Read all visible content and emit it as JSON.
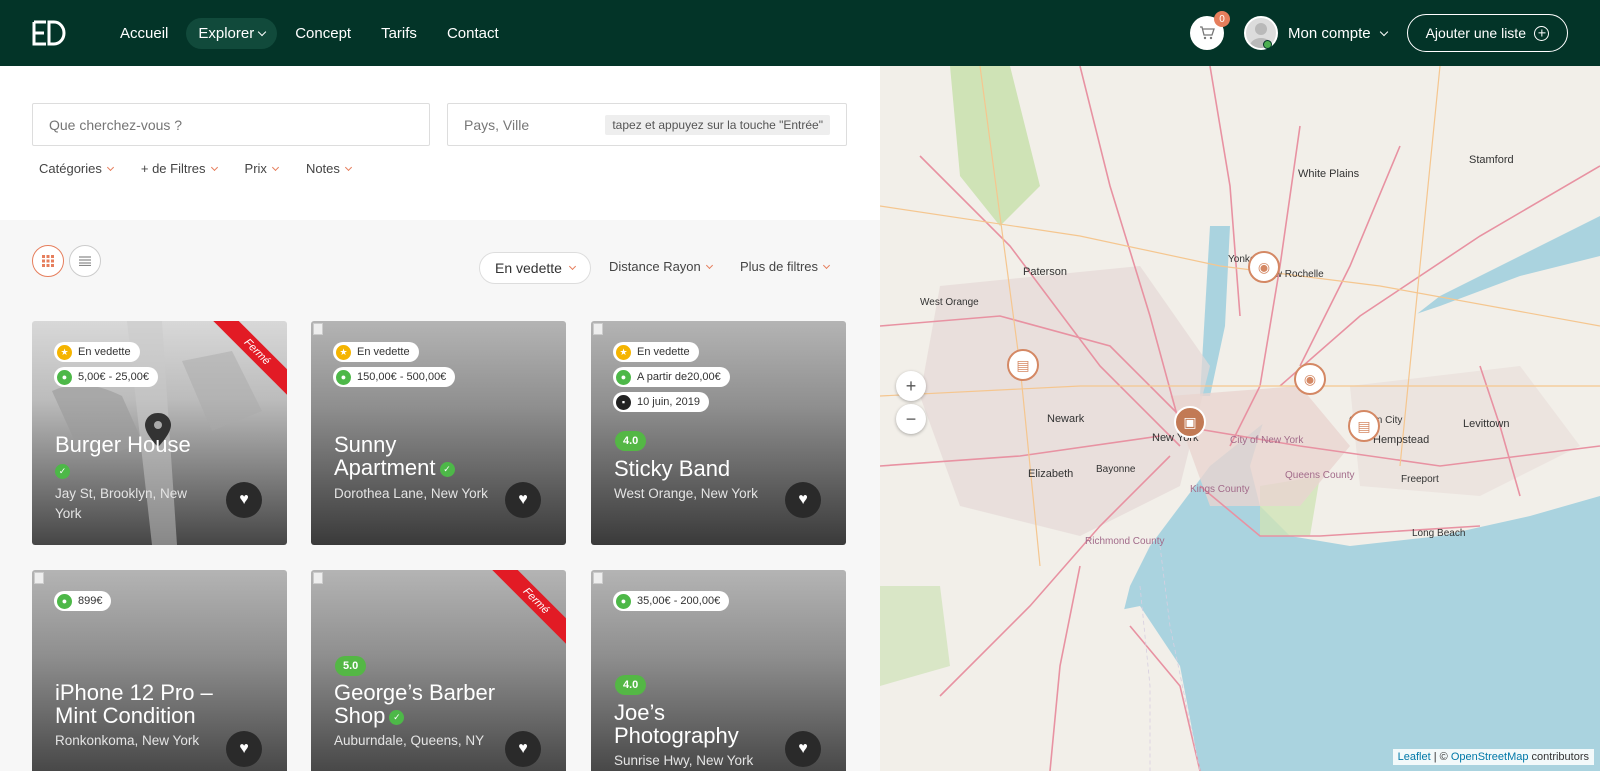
{
  "header": {
    "logo_text": "ED",
    "nav": [
      {
        "label": "Accueil"
      },
      {
        "label": "Explorer"
      },
      {
        "label": "Concept"
      },
      {
        "label": "Tarifs"
      },
      {
        "label": "Contact"
      }
    ],
    "cart_count": "0",
    "account_label": "Mon compte",
    "add_list_label": "Ajouter une liste"
  },
  "search": {
    "keyword_placeholder": "Que cherchez-vous ?",
    "location_placeholder": "Pays, Ville",
    "location_hint": "tapez et appuyez sur la touche \"Entrée\""
  },
  "filters": [
    "Catégories",
    "+ de Filtres",
    "Prix",
    "Notes"
  ],
  "toolbar": {
    "sort_label": "En vedette",
    "distance_label": "Distance Rayon",
    "more_filters_label": "Plus de filtres"
  },
  "listings": [
    {
      "title": "Burger House",
      "verified": true,
      "address": "Jay St, Brooklyn, New York",
      "featured": "En vedette",
      "price": "5,00€ - 25,00€",
      "ribbon": "Fermé"
    },
    {
      "title": "Sunny Apartment",
      "verified": true,
      "address": "Dorothea Lane, New York",
      "featured": "En vedette",
      "price": "150,00€ - 500,00€"
    },
    {
      "title": "Sticky Band",
      "address": "West Orange, New York",
      "featured": "En vedette",
      "price": "A partir de20,00€",
      "date": "10 juin, 2019",
      "rating": "4.0"
    },
    {
      "title": "iPhone 12 Pro – Mint Condition",
      "address": "Ronkonkoma, New York",
      "price": "899€"
    },
    {
      "title": "George’s Barber Shop",
      "verified": true,
      "address": "Auburndale, Queens, NY",
      "rating": "5.0",
      "ribbon": "Fermé"
    },
    {
      "title": "Joe’s Photography",
      "address": "Sunrise Hwy, New York",
      "price": "35,00€ - 200,00€",
      "rating": "4.0"
    }
  ],
  "map": {
    "zoom_in": "+",
    "zoom_out": "−",
    "attribution_leaflet": "Leaflet",
    "attribution_sep": " | © ",
    "attribution_osm": "OpenStreetMap",
    "attribution_tail": " contributors",
    "labels": [
      "White Plains",
      "Stamford",
      "Yonkers",
      "New Rochelle",
      "Paterson",
      "Newark",
      "New York",
      "Elizabeth",
      "Hempstead",
      "Levittown",
      "Long Beach",
      "Bayonne",
      "West Orange",
      "Garden City",
      "Freeport",
      "City of New York",
      "Queens County",
      "Kings County",
      "Richmond County"
    ]
  },
  "colors": {
    "header_bg": "#033428",
    "accent": "#e67e5c",
    "green": "#4db848",
    "ribbon": "#e21b25"
  }
}
